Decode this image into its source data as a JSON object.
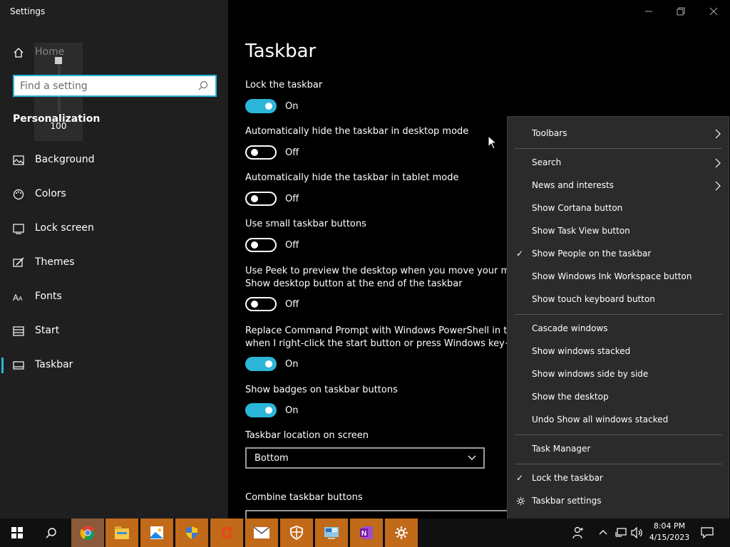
{
  "window": {
    "title": "Settings"
  },
  "sidebar": {
    "home_label": "Home",
    "search_placeholder": "Find a setting",
    "section_title": "Personalization",
    "items": [
      {
        "label": "Background",
        "icon": "picture-icon"
      },
      {
        "label": "Colors",
        "icon": "palette-icon"
      },
      {
        "label": "Lock screen",
        "icon": "lock-screen-icon"
      },
      {
        "label": "Themes",
        "icon": "brush-icon"
      },
      {
        "label": "Fonts",
        "icon": "font-icon"
      },
      {
        "label": "Start",
        "icon": "start-icon"
      },
      {
        "label": "Taskbar",
        "icon": "taskbar-icon",
        "active": true
      }
    ]
  },
  "volume": {
    "value": "100",
    "level": 1.0
  },
  "content": {
    "title": "Taskbar",
    "settings": [
      {
        "label": "Lock the taskbar",
        "state": "On"
      },
      {
        "label": "Automatically hide the taskbar in desktop mode",
        "state": "Off"
      },
      {
        "label": "Automatically hide the taskbar in tablet mode",
        "state": "Off"
      },
      {
        "label": "Use small taskbar buttons",
        "state": "Off"
      },
      {
        "label": "Use Peek to preview the desktop when you move your mou",
        "label2": "Show desktop button at the end of the taskbar",
        "state": "Off"
      },
      {
        "label": "Replace Command Prompt with Windows PowerShell in the",
        "label2": "when I right-click the start button or press Windows key+X",
        "state": "On"
      },
      {
        "label": "Show badges on taskbar buttons",
        "state": "On"
      }
    ],
    "location_label": "Taskbar location on screen",
    "location_value": "Bottom",
    "combine_label": "Combine taskbar buttons"
  },
  "context_menu": {
    "groups": [
      [
        {
          "label": "Toolbars",
          "submenu": true
        }
      ],
      [
        {
          "label": "Search",
          "submenu": true
        },
        {
          "label": "News and interests",
          "submenu": true
        },
        {
          "label": "Show Cortana button"
        },
        {
          "label": "Show Task View button"
        },
        {
          "label": "Show People on the taskbar",
          "checked": true
        },
        {
          "label": "Show Windows Ink Workspace button"
        },
        {
          "label": "Show touch keyboard button"
        }
      ],
      [
        {
          "label": "Cascade windows"
        },
        {
          "label": "Show windows stacked"
        },
        {
          "label": "Show windows side by side"
        },
        {
          "label": "Show the desktop"
        },
        {
          "label": "Undo Show all windows stacked"
        }
      ],
      [
        {
          "label": "Task Manager"
        }
      ],
      [
        {
          "label": "Lock the taskbar",
          "checked": true
        },
        {
          "label": "Taskbar settings",
          "icon": "gear-icon"
        }
      ]
    ],
    "check_glyph": "✓"
  },
  "taskbar": {
    "apps": [
      "start-icon",
      "search-icon",
      "chrome-icon",
      "file-explorer-icon",
      "photos-icon",
      "security-shield-icon",
      "office-icon",
      "mail-icon",
      "defender-icon",
      "control-panel-icon",
      "onenote-icon",
      "settings-gear-icon"
    ],
    "time": "8:04 PM",
    "date": "4/15/2023",
    "accent": "#c06a1a"
  },
  "colors": {
    "accent": "#2bb6d9",
    "sidebar_bg": "#1f1f1f",
    "menu_bg": "#2b2b2b"
  }
}
